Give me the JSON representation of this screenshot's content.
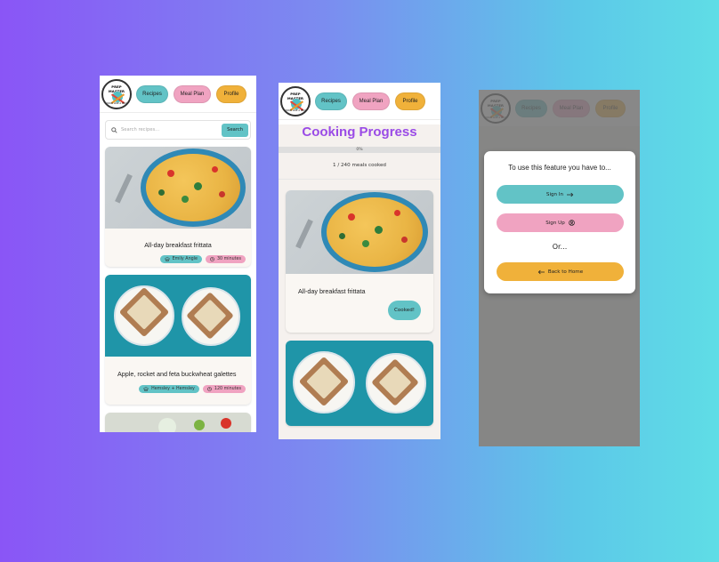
{
  "nav": {
    "recipes": "Recipes",
    "meal_plan": "Meal Plan",
    "profile": "Profile"
  },
  "logo": {
    "text_top": "PREP MASTER",
    "text_bottom": "COOK LIKE A PRO"
  },
  "search": {
    "placeholder": "Search recipes...",
    "button": "Search"
  },
  "recipes": [
    {
      "title": "All-day breakfast frittata",
      "author": "Emily Angle",
      "time": "30 minutes"
    },
    {
      "title": "Apple, rocket and feta buckwheat galettes",
      "author": "Hemsley + Hemsley",
      "time": "120 minutes"
    }
  ],
  "progress": {
    "title": "Cooking Progress",
    "percent_label": "0%",
    "percent": 0,
    "meals": "1 / 240 meals cooked",
    "card_title": "All-day breakfast frittata",
    "cooked_button": "Cooked!"
  },
  "auth_modal": {
    "title": "To use this feature you have to...",
    "sign_in": "Sign In",
    "sign_up": "Sign Up",
    "or": "Or...",
    "back": "Back to Home"
  },
  "colors": {
    "teal": "#62c3c6",
    "pink": "#f0a3c1",
    "orange": "#f0b13a",
    "purple": "#9a4be6"
  }
}
